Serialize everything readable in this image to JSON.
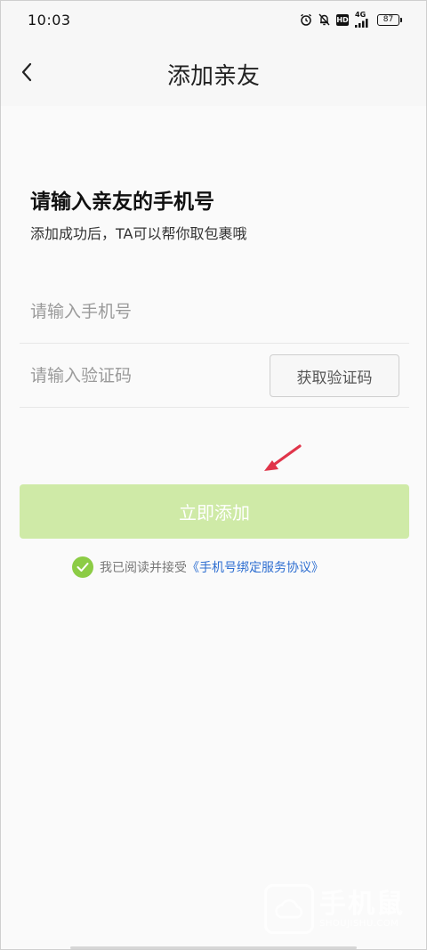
{
  "status_bar": {
    "time": "10:03",
    "hd": "HD",
    "network": "4G",
    "battery": "87"
  },
  "header": {
    "title": "添加亲友"
  },
  "form": {
    "heading": "请输入亲友的手机号",
    "subheading": "添加成功后，TA可以帮你取包裹哦",
    "phone_placeholder": "请输入手机号",
    "code_placeholder": "请输入验证码",
    "get_code_label": "获取验证码",
    "submit_label": "立即添加"
  },
  "agreement": {
    "prefix": "我已阅读并接受",
    "link": "《手机号绑定服务协议》",
    "checked": true
  },
  "watermark": {
    "title": "手机鼠",
    "sub": "SHOUJISHU.COM"
  },
  "colors": {
    "accent_green": "#8ccc45",
    "submit_disabled": "#cfeaa7",
    "link_blue": "#2f6fd1",
    "annotation_arrow": "#e0354a"
  }
}
